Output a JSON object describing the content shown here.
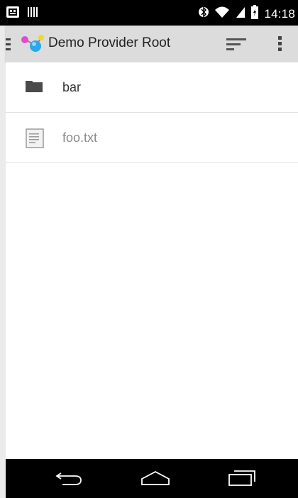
{
  "status_bar": {
    "time": "14:18",
    "left_icons": [
      "voicemail-icon",
      "barcode-icon"
    ],
    "right_icons": [
      "bluetooth-icon",
      "wifi-icon",
      "signal-icon",
      "battery-icon"
    ]
  },
  "action_bar": {
    "title": "Demo Provider Root",
    "icons": [
      "drawer-icon",
      "app-logo-icon",
      "sort-icon",
      "overflow-menu-icon"
    ]
  },
  "list": {
    "items": [
      {
        "label": "bar",
        "type": "folder",
        "icon": "folder-icon"
      },
      {
        "label": "foo.txt",
        "type": "file",
        "icon": "document-icon"
      }
    ]
  },
  "nav_bar": {
    "buttons": [
      "back-icon",
      "home-icon",
      "recents-icon"
    ]
  }
}
